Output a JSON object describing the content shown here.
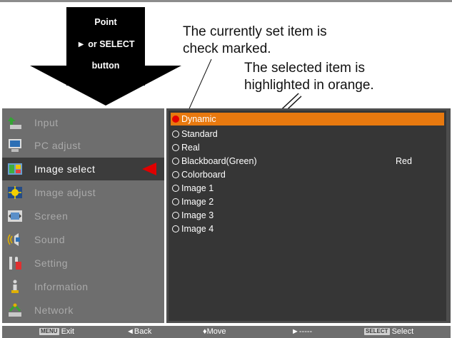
{
  "arrow": {
    "line1": "Point",
    "line2": "► or SELECT",
    "line3": "button"
  },
  "notes": {
    "current_line1": "The currently set item is",
    "current_line2": "check marked.",
    "selected_line1": "The selected item is",
    "selected_line2": "highlighted in orange."
  },
  "colors": {
    "highlight": "#e8790f",
    "marker": "#e00000",
    "menu_bg": "#6e6e6e",
    "panel_bg": "#363636"
  },
  "menu": {
    "items": [
      {
        "label": "Input",
        "icon": "input-icon"
      },
      {
        "label": "PC adjust",
        "icon": "pc-adjust-icon"
      },
      {
        "label": "Image select",
        "icon": "image-select-icon",
        "active": true
      },
      {
        "label": "Image adjust",
        "icon": "image-adjust-icon"
      },
      {
        "label": "Screen",
        "icon": "screen-icon"
      },
      {
        "label": "Sound",
        "icon": "sound-icon"
      },
      {
        "label": "Setting",
        "icon": "setting-icon"
      },
      {
        "label": "Information",
        "icon": "information-icon"
      },
      {
        "label": "Network",
        "icon": "network-icon"
      }
    ]
  },
  "options": [
    {
      "label": "Dynamic",
      "checked": true,
      "selected": true
    },
    {
      "label": "Standard"
    },
    {
      "label": "Real"
    },
    {
      "label": "Blackboard(Green)",
      "value": "Red"
    },
    {
      "label": "Colorboard"
    },
    {
      "label": "Image 1"
    },
    {
      "label": "Image 2"
    },
    {
      "label": "Image 3"
    },
    {
      "label": "Image 4"
    }
  ],
  "bottom": {
    "exit_key": "MENU",
    "exit": "Exit",
    "back": "◄Back",
    "move": "♦Move",
    "next": "►-----",
    "select_key": "SELECT",
    "select": "Select"
  }
}
